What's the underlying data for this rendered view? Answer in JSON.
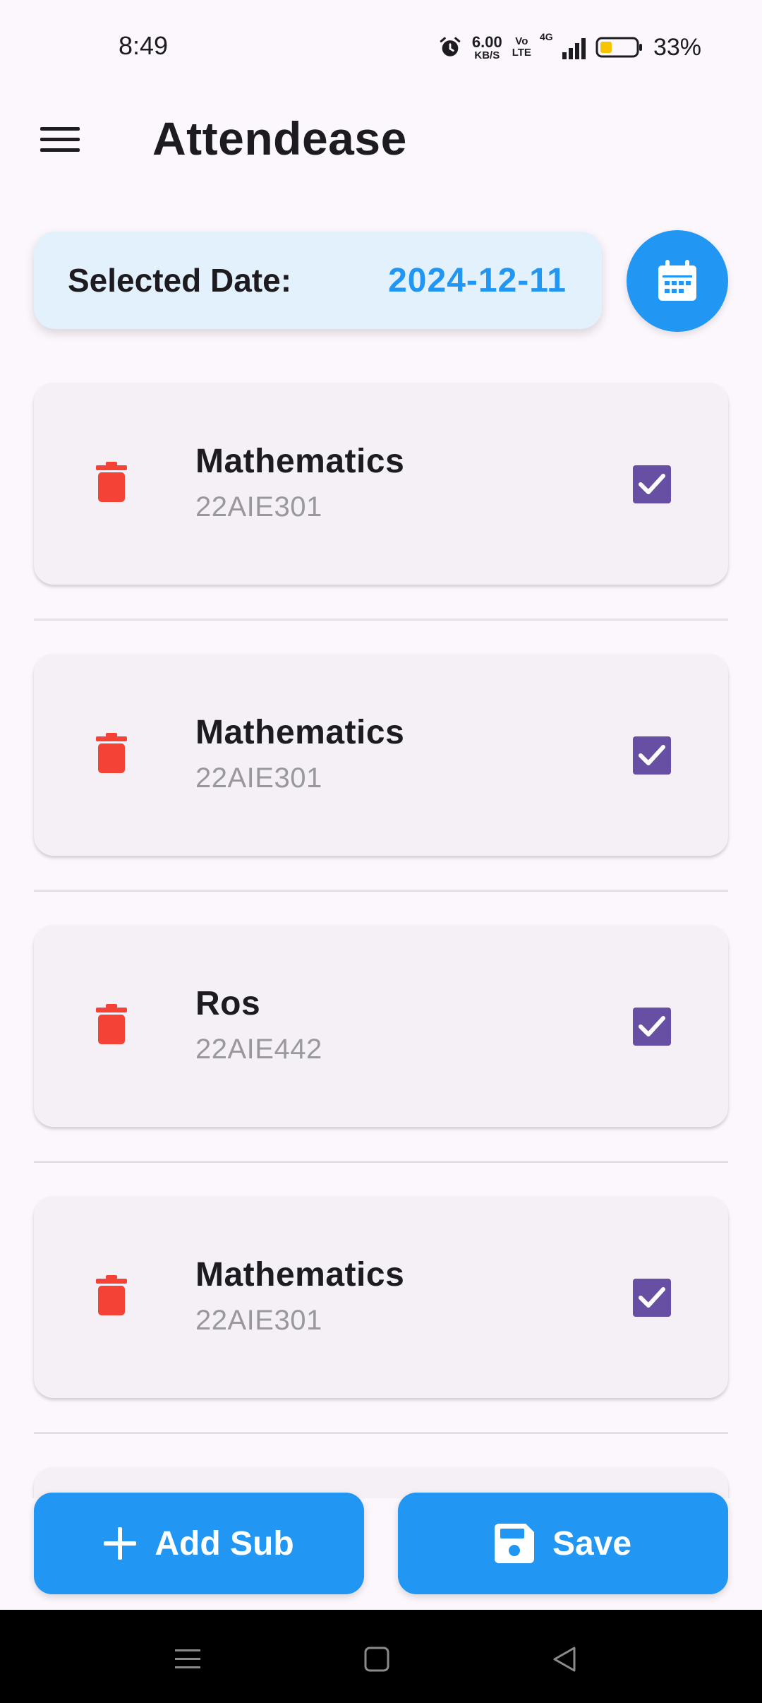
{
  "status_bar": {
    "time": "8:49",
    "net_speed_value": "6.00",
    "net_speed_unit": "KB/S",
    "volte_top": "Vo",
    "volte_bottom": "LTE",
    "network": "4G",
    "battery_percent": "33%"
  },
  "app_bar": {
    "title": "Attendease",
    "menu_icon": "hamburger-menu-icon"
  },
  "date_selector": {
    "label": "Selected Date:",
    "value": "2024-12-11",
    "calendar_icon": "calendar-icon"
  },
  "subjects": [
    {
      "name": "Mathematics",
      "code": "22AIE301",
      "checked": true
    },
    {
      "name": "Mathematics",
      "code": "22AIE301",
      "checked": true
    },
    {
      "name": "Ros",
      "code": "22AIE442",
      "checked": true
    },
    {
      "name": "Mathematics",
      "code": "22AIE301",
      "checked": true
    }
  ],
  "actions": {
    "add_label": "Add Sub",
    "save_label": "Save"
  },
  "colors": {
    "primary": "#2196f3",
    "delete": "#f44336",
    "checkbox": "#6750a4",
    "date_card_bg": "#e2f1fb",
    "card_bg": "#f4f0f6",
    "page_bg": "#fcf7fc"
  }
}
